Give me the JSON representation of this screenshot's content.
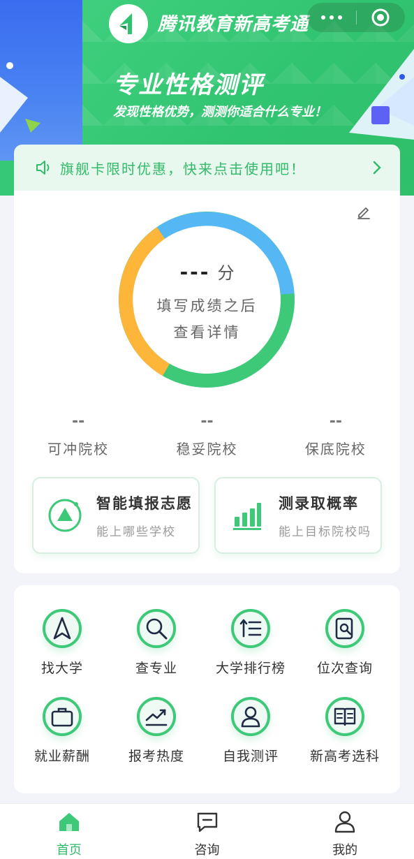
{
  "app": {
    "title": "腾讯教育新高考通"
  },
  "hero": {
    "title": "专业性格测评",
    "subtitle": "发现性格优势，测测你适合什么专业！"
  },
  "notice": {
    "text": "旗舰卡限时优惠，快来点击使用吧！"
  },
  "score": {
    "value": "---",
    "unit": "分",
    "hint_line1": "填写成绩之后",
    "hint_line2": "查看详情"
  },
  "categories": [
    {
      "value": "--",
      "label": "可冲院校"
    },
    {
      "value": "--",
      "label": "稳妥院校"
    },
    {
      "value": "--",
      "label": "保底院校"
    }
  ],
  "actions": [
    {
      "title": "智能填报志愿",
      "subtitle": "能上哪些学校",
      "icon": "triangle-target-icon"
    },
    {
      "title": "测录取概率",
      "subtitle": "能上目标院校吗",
      "icon": "bar-chart-icon"
    }
  ],
  "tools": [
    {
      "label": "找大学",
      "icon": "navigation-arrow-icon"
    },
    {
      "label": "查专业",
      "icon": "search-icon"
    },
    {
      "label": "大学排行榜",
      "icon": "ranking-list-icon"
    },
    {
      "label": "位次查询",
      "icon": "document-search-icon"
    },
    {
      "label": "就业薪酬",
      "icon": "briefcase-icon"
    },
    {
      "label": "报考热度",
      "icon": "trend-chart-icon"
    },
    {
      "label": "自我测评",
      "icon": "person-icon"
    },
    {
      "label": "新高考选科",
      "icon": "book-icon"
    }
  ],
  "tabs": [
    {
      "label": "首页",
      "icon": "home-icon",
      "active": true
    },
    {
      "label": "咨询",
      "icon": "chat-icon",
      "active": false
    },
    {
      "label": "我的",
      "icon": "user-icon",
      "active": false
    }
  ],
  "colors": {
    "brand_green": "#33bb6a",
    "ring_blue": "#56b7f5",
    "ring_green": "#3ec979",
    "ring_orange": "#fdb63a",
    "banner_blue": "#3a6cf0"
  }
}
